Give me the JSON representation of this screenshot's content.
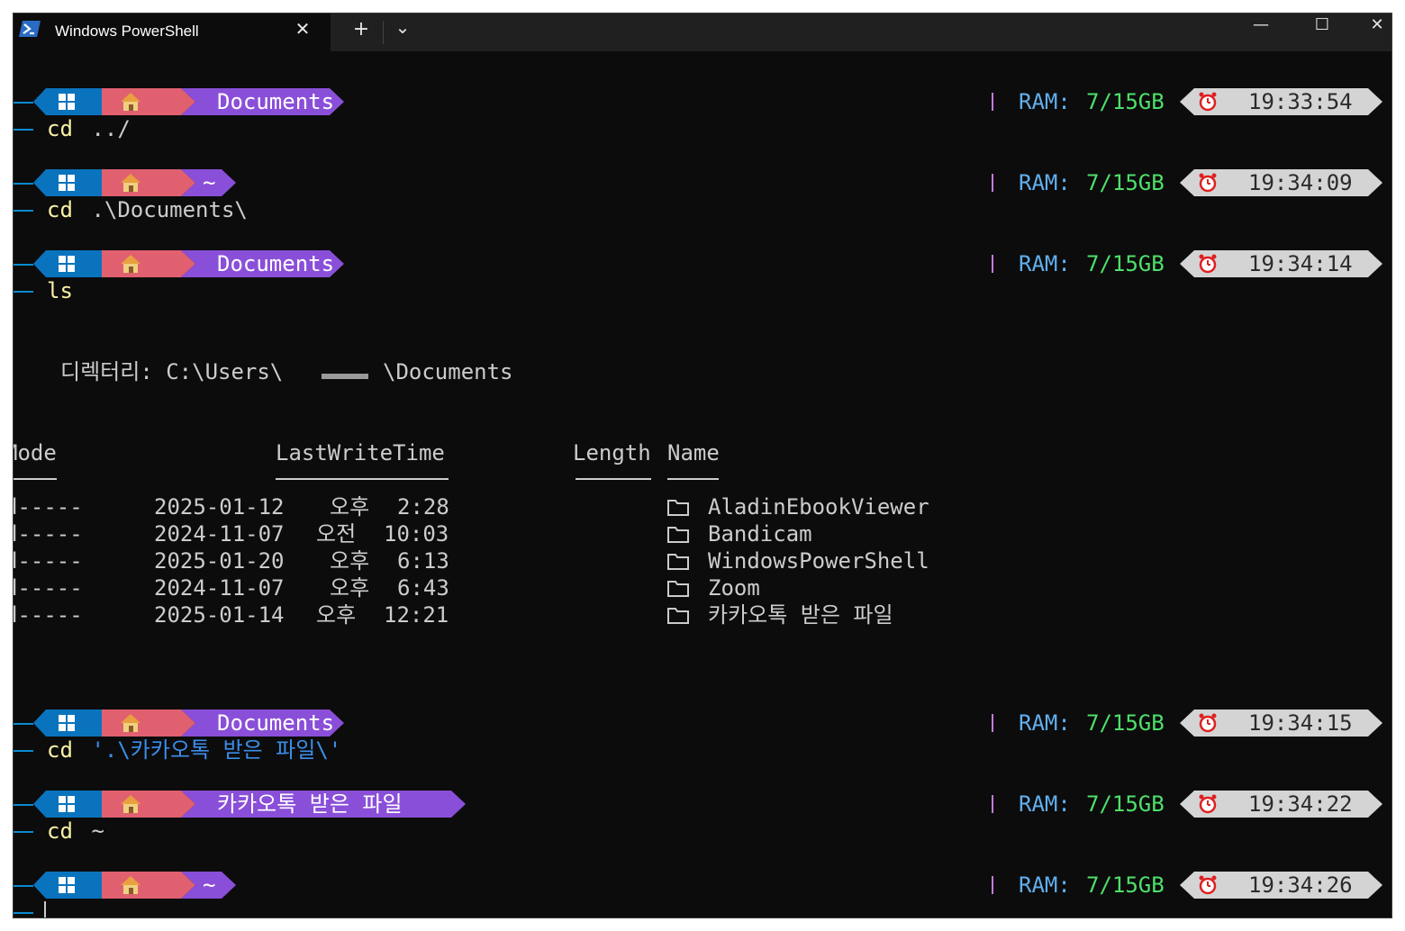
{
  "window": {
    "tab_title": "Windows PowerShell",
    "close_glyph": "✕",
    "new_tab_glyph": "+",
    "dropdown_glyph": "⌄",
    "minimize_glyph": "—",
    "maximize_glyph": "☐",
    "close_window_glyph": "✕"
  },
  "prompts": [
    {
      "path": "Documents",
      "time": "19:33:54",
      "ram_label": "RAM:",
      "ram_value": "7/15GB",
      "cmd": "cd",
      "arg": " ../"
    },
    {
      "path": "~",
      "time": "19:34:09",
      "ram_label": "RAM:",
      "ram_value": "7/15GB",
      "cmd": "cd",
      "arg": " .\\Documents\\"
    },
    {
      "path": "Documents",
      "time": "19:34:14",
      "ram_label": "RAM:",
      "ram_value": "7/15GB",
      "cmd": "ls",
      "arg": ""
    },
    {
      "path": "Documents",
      "time": "19:34:15",
      "ram_label": "RAM:",
      "ram_value": "7/15GB",
      "cmd": "cd",
      "arg": " '.\\카카오톡 받은 파일\\'"
    },
    {
      "path": "카카오톡 받은 파일",
      "time": "19:34:22",
      "ram_label": "RAM:",
      "ram_value": "7/15GB",
      "cmd": "cd",
      "arg": " ~"
    },
    {
      "path": "~",
      "time": "19:34:26",
      "ram_label": "RAM:",
      "ram_value": "7/15GB",
      "cmd": "",
      "arg": ""
    }
  ],
  "listing": {
    "directory_label": "디렉터리: C:\\Users\\",
    "directory_suffix": "\\Documents",
    "headers": {
      "mode": "Mode",
      "lastwritetime": "LastWriteTime",
      "length": "Length",
      "name": "Name"
    },
    "rows": [
      {
        "mode": "d-----",
        "date": "2025-01-12",
        "ampm": "오후",
        "time": "2:28",
        "name": "AladinEbookViewer"
      },
      {
        "mode": "d-----",
        "date": "2024-11-07",
        "ampm": "오전",
        "time": "10:03",
        "name": "Bandicam"
      },
      {
        "mode": "d-----",
        "date": "2025-01-20",
        "ampm": "오후",
        "time": "6:13",
        "name": "WindowsPowerShell"
      },
      {
        "mode": "d-----",
        "date": "2024-11-07",
        "ampm": "오후",
        "time": "6:43",
        "name": "Zoom"
      },
      {
        "mode": "d-----",
        "date": "2025-01-14",
        "ampm": "오후",
        "time": "12:21",
        "name": "카카오톡 받은 파일"
      }
    ]
  },
  "colors": {
    "background": "#0c0c0c",
    "segment_windows": "#0a73bd",
    "segment_home": "#e06070",
    "segment_path": "#8a4fd8",
    "ram_label": "#61afef",
    "ram_value": "#4ee06a",
    "command": "#f9f1a5"
  }
}
